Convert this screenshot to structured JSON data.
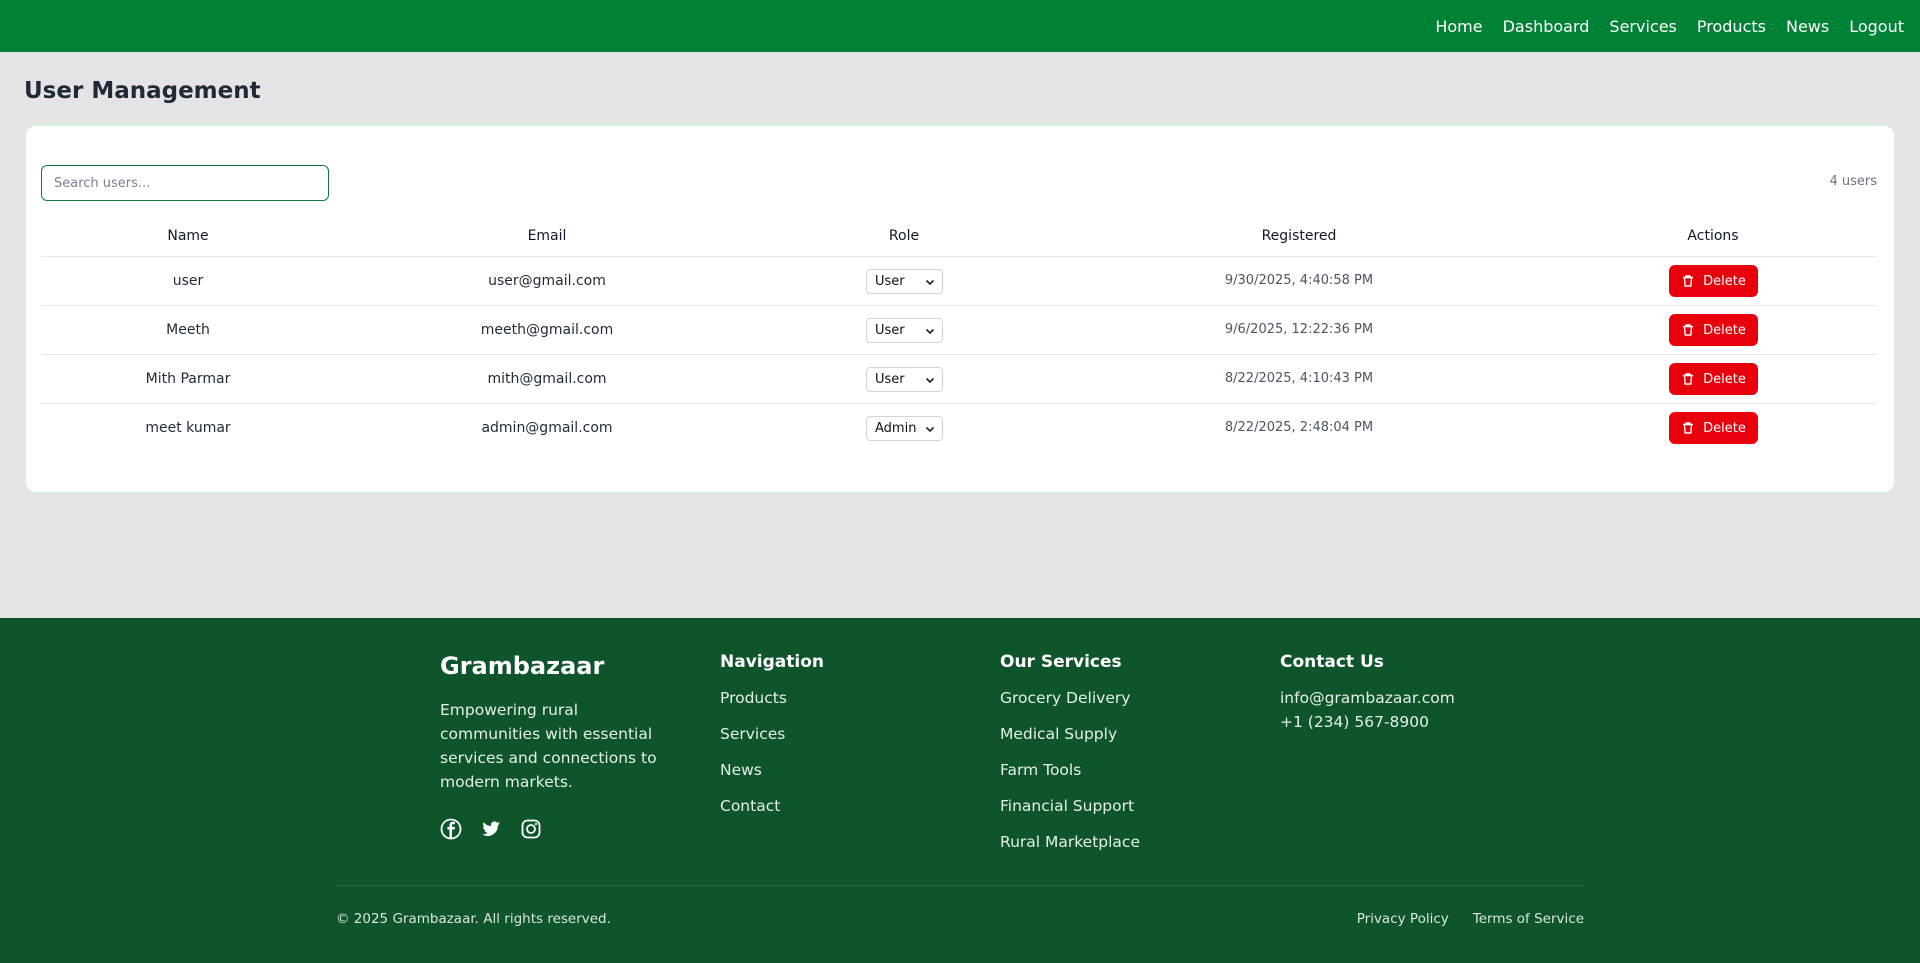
{
  "topnav": {
    "items": [
      "Home",
      "Dashboard",
      "Services",
      "Products",
      "News",
      "Logout"
    ]
  },
  "page": {
    "title": "User Management"
  },
  "search": {
    "placeholder": "Search users...",
    "value": ""
  },
  "user_count": "4 users",
  "table": {
    "headers": [
      "Name",
      "Email",
      "Role",
      "Registered",
      "Actions"
    ],
    "rows": [
      {
        "name": "user",
        "email": "user@gmail.com",
        "role": "User",
        "registered": "9/30/2025, 4:40:58 PM",
        "action": "Delete"
      },
      {
        "name": "Meeth",
        "email": "meeth@gmail.com",
        "role": "User",
        "registered": "9/6/2025, 12:22:36 PM",
        "action": "Delete"
      },
      {
        "name": "Mith Parmar",
        "email": "mith@gmail.com",
        "role": "User",
        "registered": "8/22/2025, 4:10:43 PM",
        "action": "Delete"
      },
      {
        "name": "meet kumar",
        "email": "admin@gmail.com",
        "role": "Admin",
        "registered": "8/22/2025, 2:48:04 PM",
        "action": "Delete"
      }
    ]
  },
  "footer": {
    "brand": "Grambazaar",
    "tagline": "Empowering rural communities with essential services and connections to modern markets.",
    "social_icons": [
      "facebook-icon",
      "twitter-icon",
      "instagram-icon"
    ],
    "navigation": {
      "title": "Navigation",
      "links": [
        "Products",
        "Services",
        "News",
        "Contact"
      ]
    },
    "services": {
      "title": "Our Services",
      "links": [
        "Grocery Delivery",
        "Medical Supply",
        "Farm Tools",
        "Financial Support",
        "Rural Marketplace"
      ]
    },
    "contact": {
      "title": "Contact Us",
      "email": "info@grambazaar.com",
      "phone": "+1 (234) 567-8900"
    },
    "copyright": "© 2025 Grambazaar. All rights reserved.",
    "legal": [
      "Privacy Policy",
      "Terms of Service"
    ]
  },
  "colors": {
    "header_green": "#008236",
    "footer_green": "#0e552c",
    "delete_red": "#e7000b",
    "page_bg": "#e4e4e6"
  }
}
